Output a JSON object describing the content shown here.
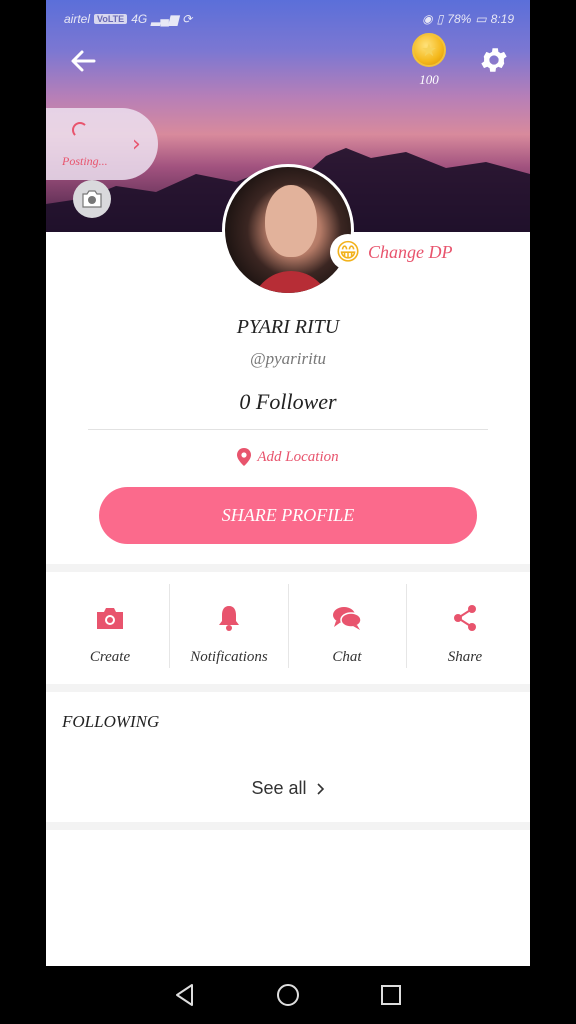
{
  "status_bar": {
    "carrier": "airtel",
    "volte": "VoLTE",
    "network": "4G",
    "battery": "78%",
    "time": "8:19"
  },
  "header": {
    "coin_count": "100"
  },
  "posting": {
    "label": "Posting..."
  },
  "profile": {
    "change_dp_label": "Change DP",
    "name": "PYARI RITU",
    "handle": "@pyariritu",
    "followers": "0 Follower",
    "location_label": "Add Location",
    "share_label": "SHARE PROFILE"
  },
  "actions": [
    {
      "label": "Create",
      "icon": "camera-icon"
    },
    {
      "label": "Notifications",
      "icon": "bell-icon"
    },
    {
      "label": "Chat",
      "icon": "chat-icon"
    },
    {
      "label": "Share",
      "icon": "share-icon"
    }
  ],
  "following": {
    "title": "FOLLOWING",
    "see_all": "See all"
  },
  "colors": {
    "accent": "#fb6a8c",
    "accent_text": "#e8546d"
  }
}
